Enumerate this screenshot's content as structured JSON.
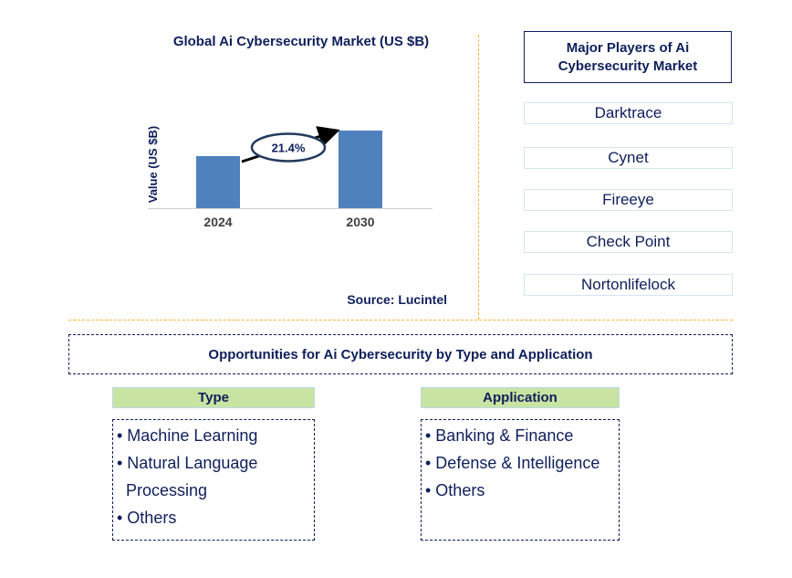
{
  "chart_data": {
    "type": "bar",
    "title": "Global Ai Cybersecurity Market (US $B)",
    "xlabel": "",
    "ylabel": "Value (US $B)",
    "categories": [
      "2024",
      "2030"
    ],
    "values": [
      57,
      85
    ],
    "values_note": "relative bar heights estimated; no values printed",
    "ylim": [
      0,
      100
    ],
    "grid": false,
    "annotation": {
      "text": "21.4%",
      "meaning": "CAGR 2024-2030"
    },
    "bar_color": "#4f81bd"
  },
  "source": "Source: Lucintel",
  "players": {
    "title": "Major Players of Ai Cybersecurity Market",
    "items": [
      "Darktrace",
      "Cynet",
      "Fireeye",
      "Check Point",
      "Nortonlifelock"
    ]
  },
  "opportunities": {
    "title": "Opportunities for Ai Cybersecurity by Type and Application",
    "type": {
      "header": "Type",
      "items": [
        "• Machine Learning",
        "• Natural Language",
        "Processing",
        "• Others"
      ]
    },
    "application": {
      "header": "Application",
      "items": [
        "• Banking & Finance",
        "• Defense & Intelligence",
        "• Others"
      ]
    }
  },
  "colors": {
    "text": "#0e1f5b",
    "bar": "#4f81bd",
    "separator": "#f2b632",
    "category_header": "#c9e3a2"
  }
}
